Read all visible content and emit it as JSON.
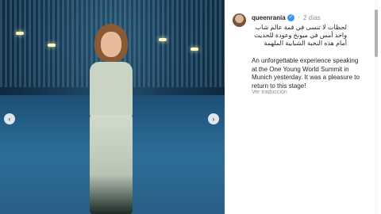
{
  "post": {
    "username": "queenrania",
    "time_separator": "·",
    "time": "2 días",
    "caption_ar": "لحظات لا تنسى في قمة عالم شاب واحد أمس في ميونخ وعودة للحديث أمام هذه النخبة الشبابية الملهمة",
    "caption_en": "An unforgettable experience speaking at the One Young World Summit in Munich yesterday. It was a pleasure to return to this stage!",
    "translate": "Ver traducción"
  },
  "carousel": {
    "prev_glyph": "‹",
    "next_glyph": "›"
  },
  "icons": {
    "verified": "verified-badge-icon"
  },
  "colors": {
    "accent": "#3897f0"
  }
}
